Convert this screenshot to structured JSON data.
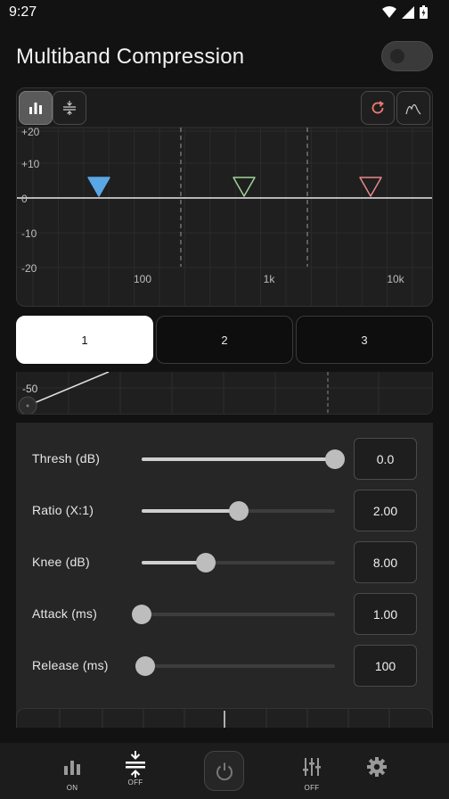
{
  "status": {
    "time": "9:27"
  },
  "header": {
    "title": "Multiband Compression",
    "enabled": false
  },
  "graph": {
    "y_ticks": [
      "+20",
      "+10",
      "0",
      "-10",
      "-20"
    ],
    "x_ticks": [
      "100",
      "1k",
      "10k"
    ],
    "markers": [
      {
        "band": "1",
        "color": "#5aa7e6",
        "filled": true
      },
      {
        "band": "2",
        "color": "#9fd39a",
        "filled": false
      },
      {
        "band": "3",
        "color": "#e58a8a",
        "filled": false
      }
    ]
  },
  "tabs": [
    {
      "label": "1",
      "selected": true
    },
    {
      "label": "2",
      "selected": false
    },
    {
      "label": "3",
      "selected": false
    }
  ],
  "transfer": {
    "label": "-50"
  },
  "params": [
    {
      "name": "Thresh (dB)",
      "value": "0.0",
      "level": 1.0
    },
    {
      "name": "Ratio (X:1)",
      "value": "2.00",
      "level": 0.5
    },
    {
      "name": "Knee (dB)",
      "value": "8.00",
      "level": 0.33
    },
    {
      "name": "Attack (ms)",
      "value": "1.00",
      "level": 0.0
    },
    {
      "name": "Release (ms)",
      "value": "100",
      "level": 0.02
    }
  ],
  "nav": {
    "items": [
      {
        "icon": "bars-icon",
        "caption": "ON"
      },
      {
        "icon": "compress-icon",
        "caption": "OFF"
      },
      {
        "icon": "power-icon",
        "caption": ""
      },
      {
        "icon": "sliders-icon",
        "caption": "OFF"
      },
      {
        "icon": "gear-icon",
        "caption": ""
      }
    ]
  }
}
